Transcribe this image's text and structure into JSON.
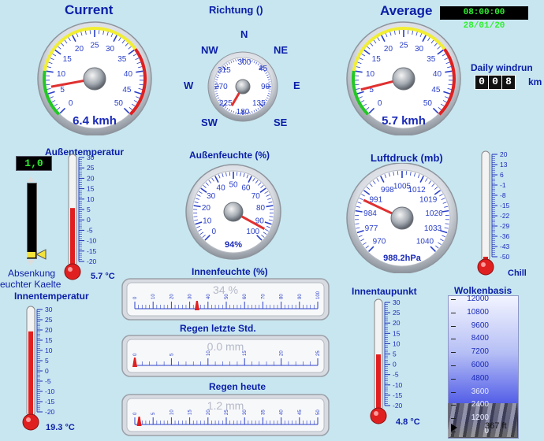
{
  "header": {
    "current": "Current",
    "direction": "Richtung ()",
    "average": "Average",
    "datetime": "08:00:00 28/01/20"
  },
  "windrun": {
    "label": "Daily windrun",
    "unit": "km",
    "digits": "008"
  },
  "current_gauge": {
    "value": 6.4,
    "value_text": "6.4 kmh",
    "ticks": [
      "0",
      "5",
      "10",
      "15",
      "20",
      "25",
      "30",
      "35",
      "40",
      "45",
      "50"
    ]
  },
  "average_gauge": {
    "value": 5.7,
    "value_text": "5.7 kmh",
    "ticks": [
      "0",
      "5",
      "10",
      "15",
      "20",
      "25",
      "30",
      "35",
      "40",
      "45",
      "50"
    ]
  },
  "compass": {
    "directions": {
      "n": "N",
      "ne": "NE",
      "e": "E",
      "se": "SE",
      "s": "S",
      "sw": "SW",
      "w": "W",
      "nw": "NW"
    },
    "degrees": [
      "0",
      "45",
      "90",
      "135",
      "180",
      "225",
      "270",
      "315",
      "300"
    ],
    "pointer_deg": 210
  },
  "outdoor_temp": {
    "label": "Außentemperatur",
    "value": 5.7,
    "value_text": "5.7 °C",
    "ticks": [
      "30",
      "25",
      "20",
      "15",
      "10",
      "5",
      "0",
      "-5",
      "-10",
      "-15",
      "-20"
    ]
  },
  "setpoint": {
    "value": "1,0",
    "label1": "Absenkung",
    "label2": "euchter Kaelte"
  },
  "outdoor_humidity": {
    "label": "Außenfeuchte (%)",
    "value": 94,
    "value_text": "94%",
    "ticks": [
      "0",
      "10",
      "20",
      "30",
      "40",
      "50",
      "60",
      "70",
      "80",
      "90",
      "100"
    ]
  },
  "pressure": {
    "label": "Luftdruck (mb)",
    "value": 988.2,
    "value_text": "988.2hPa",
    "ticks": [
      "970",
      "977",
      "984",
      "991",
      "998",
      "1005",
      "1012",
      "1019",
      "1026",
      "1033",
      "1040"
    ]
  },
  "chill": {
    "label": "Chill",
    "value": -50,
    "ticks": [
      "20",
      "13",
      "6",
      "-1",
      "-8",
      "-15",
      "-22",
      "-29",
      "-36",
      "-43",
      "-50"
    ]
  },
  "indoor_temp": {
    "label": "Innentemperatur",
    "value": 19.3,
    "value_text": "19.3 °C",
    "ticks": [
      "30",
      "25",
      "20",
      "15",
      "10",
      "5",
      "0",
      "-5",
      "-10",
      "-15",
      "-20"
    ]
  },
  "indoor_humidity": {
    "label": "Innenfeuchte (%)",
    "value": 34,
    "value_text": "34 %",
    "ticks": [
      "0",
      "10",
      "20",
      "30",
      "40",
      "50",
      "60",
      "70",
      "80",
      "90",
      "100"
    ]
  },
  "rain_hour": {
    "label": "Regen letzte Std.",
    "value": 0,
    "value_text": "0.0 mm",
    "ticks": [
      "0",
      "5",
      "10",
      "15",
      "20",
      "25"
    ]
  },
  "rain_today": {
    "label": "Regen heute",
    "value": 1.2,
    "value_text": "1.2 mm",
    "ticks": [
      "0",
      "5",
      "10",
      "15",
      "20",
      "25",
      "30",
      "35",
      "40",
      "45",
      "50"
    ]
  },
  "dewpoint": {
    "label": "Innentaupunkt",
    "value": 4.8,
    "value_text": "4.8 °C",
    "ticks": [
      "30",
      "25",
      "20",
      "15",
      "10",
      "5",
      "0",
      "-5",
      "-10",
      "-15",
      "-20"
    ]
  },
  "cloudbase": {
    "label": "Wolkenbasis",
    "value_text": "367 ft",
    "ticks": [
      "12000",
      "10800",
      "9600",
      "8400",
      "7200",
      "6000",
      "4800",
      "3600",
      "2400",
      "1200",
      "0"
    ]
  },
  "colors": {
    "title": "#0a1ea8",
    "needle": "#e03030",
    "lcd": "#2ef12e"
  }
}
